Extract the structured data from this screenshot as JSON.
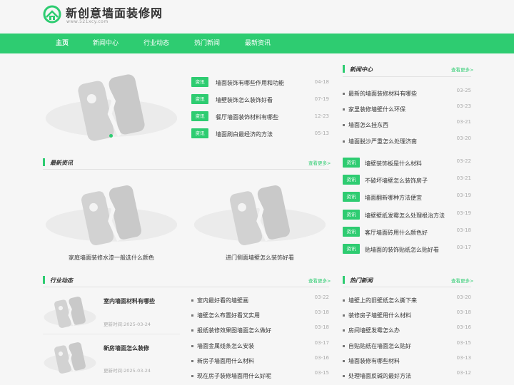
{
  "colors": {
    "accent": "#2ecc71",
    "background": "#f6f6f6",
    "text": "#333333",
    "muted": "#aaaaaa"
  },
  "header": {
    "site_name": "新创意墙面装修网",
    "site_url": "www.521xcy.com",
    "logo_icon": "house-leaf-icon"
  },
  "nav": [
    {
      "label": "主页",
      "active": true
    },
    {
      "label": "新闻中心",
      "active": false
    },
    {
      "label": "行业动态",
      "active": false
    },
    {
      "label": "热门新闻",
      "active": false
    },
    {
      "label": "最新资讯",
      "active": false
    }
  ],
  "tag_label": "资讯",
  "more_label": "查看更多>",
  "time_label": "更新时间:",
  "featured": [
    {
      "title": "墙面装饰有哪些作用和功能",
      "date": "04-18"
    },
    {
      "title": "墙壁装饰怎么装饰好看",
      "date": "07-19"
    },
    {
      "title": "餐厅墙面装饰材料有哪些",
      "date": "12-23"
    },
    {
      "title": "墙面刷白最经济的方法",
      "date": "05-13"
    }
  ],
  "latest": {
    "title": "最新资讯",
    "items": [
      {
        "caption": "家庭墙面装修水漆一般选什么颜色"
      },
      {
        "caption": "进门侧面墙壁怎么装饰好看"
      }
    ]
  },
  "industry": {
    "title": "行业动态",
    "cards": [
      {
        "title": "室内墙面材料有哪些",
        "time": "2025-03-24"
      },
      {
        "title": "新房墙面怎么装修",
        "time": "2025-03-24"
      }
    ],
    "list": [
      {
        "title": "室内最好看的墙壁画",
        "date": "03-22"
      },
      {
        "title": "墙壁怎么布置好看又实用",
        "date": "03-18"
      },
      {
        "title": "报纸装修效果图墙面怎么做好",
        "date": "03-18"
      },
      {
        "title": "墙面金属线条怎么安装",
        "date": "03-17"
      },
      {
        "title": "新房子墙面用什么材料",
        "date": "03-16"
      },
      {
        "title": "现在房子装修墙面用什么好呢",
        "date": "03-15"
      }
    ]
  },
  "news_center": {
    "title": "新闻中心",
    "list": [
      {
        "title": "最新的墙面装修材料有哪些",
        "date": "03-25"
      },
      {
        "title": "家里装修墙壁什么环保",
        "date": "03-23"
      },
      {
        "title": "墙面怎么挂东西",
        "date": "03-21"
      },
      {
        "title": "墙面脱沙严重怎么处理济南",
        "date": "03-20"
      }
    ],
    "tagged": [
      {
        "title": "墙壁装饰板是什么材料",
        "date": "03-22"
      },
      {
        "title": "不破坏墙壁怎么装饰房子",
        "date": "03-21"
      },
      {
        "title": "墙面翻新哪种方法便宜",
        "date": "03-19"
      },
      {
        "title": "墙壁壁纸发霉怎么处理根治方法",
        "date": "03-19"
      },
      {
        "title": "客厅墙面砖用什么颜色好",
        "date": "03-18"
      },
      {
        "title": "贴墙面的装饰贴纸怎么贴好看",
        "date": "03-17"
      }
    ]
  },
  "hot_news": {
    "title": "热门新闻",
    "list": [
      {
        "title": "墙壁上的旧壁纸怎么撕下来",
        "date": "03-20"
      },
      {
        "title": "装修房子墙壁用什么材料",
        "date": "03-18"
      },
      {
        "title": "房间墙壁发霉怎么办",
        "date": "03-16"
      },
      {
        "title": "自贴贴纸在墙面怎么贴好",
        "date": "03-15"
      },
      {
        "title": "墙面装修有哪些材料",
        "date": "03-13"
      },
      {
        "title": "处理墙面反碱的最好方法",
        "date": "03-12"
      }
    ]
  }
}
